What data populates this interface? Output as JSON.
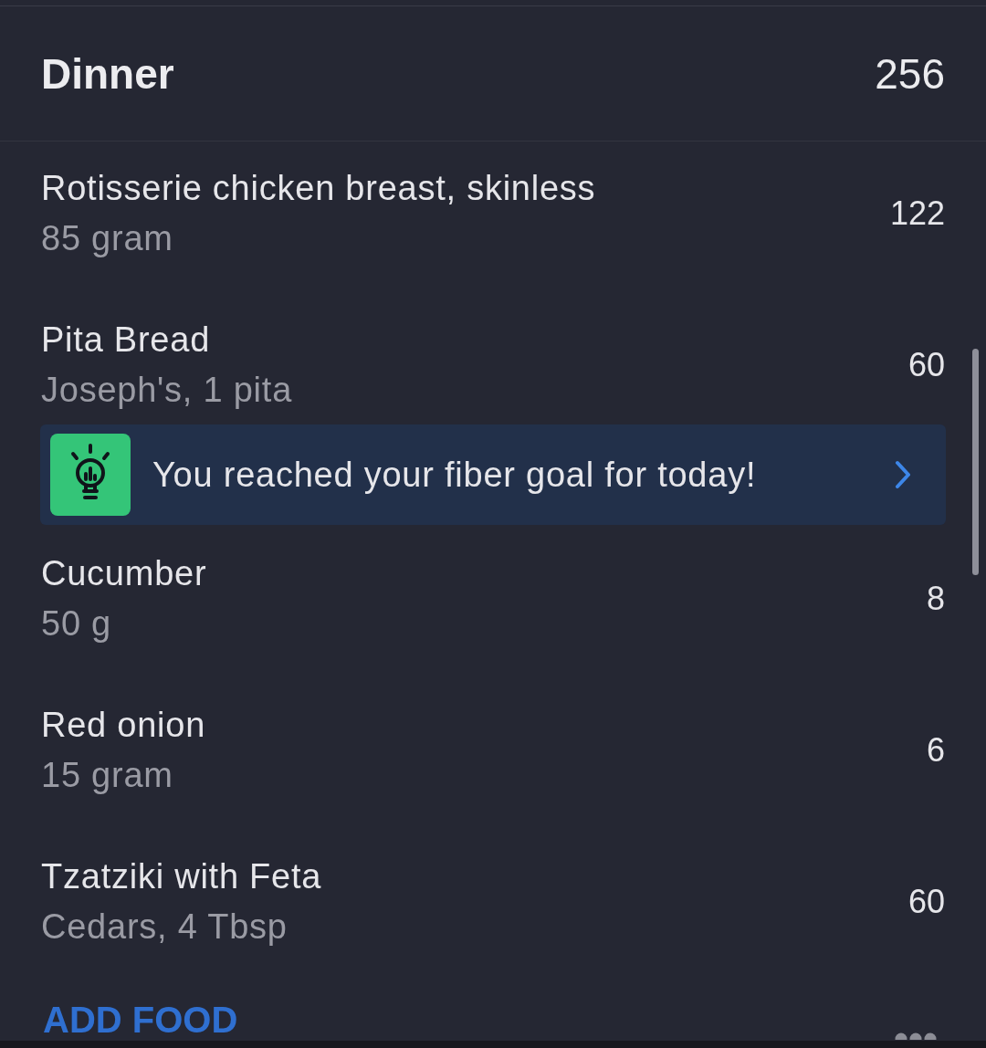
{
  "meal": {
    "title": "Dinner",
    "calories": "256"
  },
  "entries": [
    {
      "kind": "food",
      "name": "Rotisserie chicken breast, skinless",
      "serving": "85 gram",
      "calories": "122"
    },
    {
      "kind": "food",
      "name": "Pita Bread",
      "serving": "Joseph's, 1 pita",
      "calories": "60"
    },
    {
      "kind": "tip",
      "text": "You reached your fiber goal for today!"
    },
    {
      "kind": "food",
      "name": "Cucumber",
      "serving": "50 g",
      "calories": "8"
    },
    {
      "kind": "food",
      "name": "Red onion",
      "serving": "15 gram",
      "calories": "6"
    },
    {
      "kind": "food",
      "name": "Tzatziki with Feta",
      "serving": "Cedars, 4 Tbsp",
      "calories": "60"
    }
  ],
  "footer": {
    "add_button": "ADD FOOD"
  }
}
